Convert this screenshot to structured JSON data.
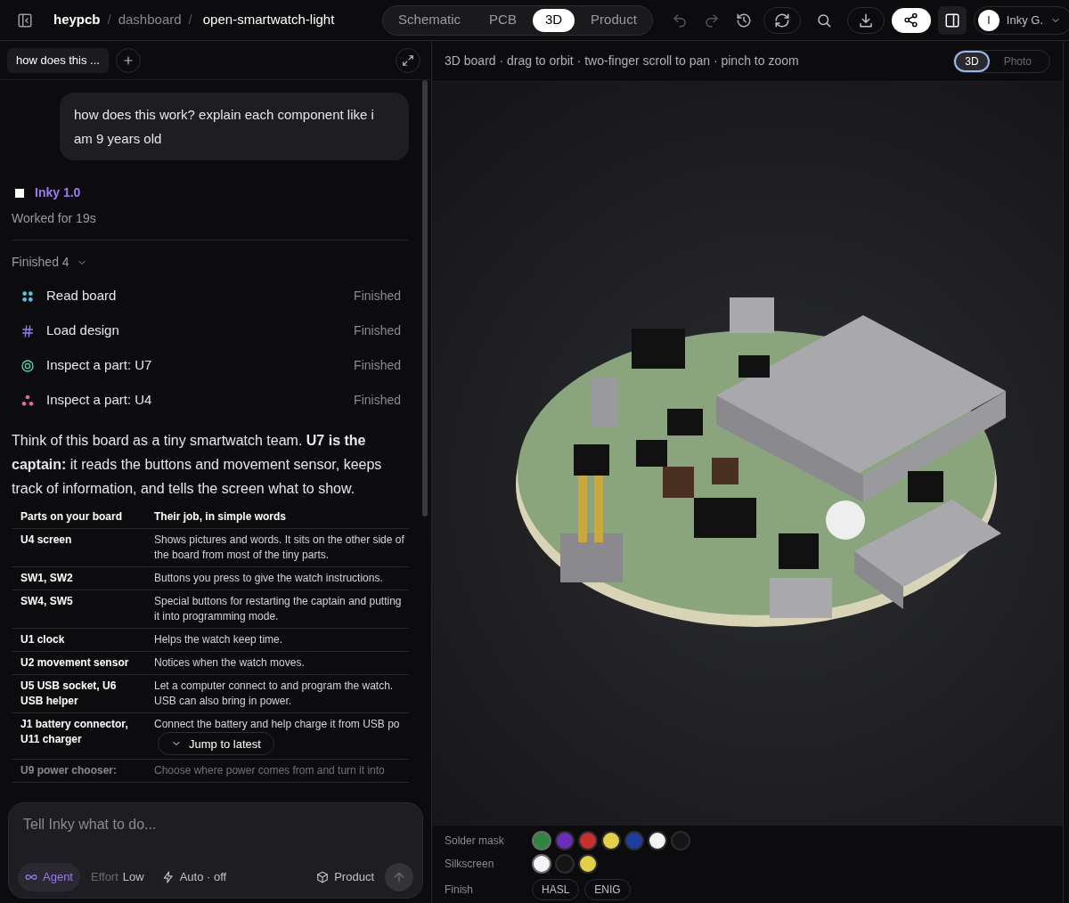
{
  "header": {
    "breadcrumb": [
      "heypcb",
      "dashboard",
      "open-smartwatch-light"
    ],
    "breadcrumb_separators": [
      "/",
      "/"
    ],
    "views": [
      {
        "label": "Schematic",
        "selected": false
      },
      {
        "label": "PCB",
        "selected": false
      },
      {
        "label": "3D",
        "selected": true
      },
      {
        "label": "Product",
        "selected": false
      }
    ],
    "user": {
      "initial": "I",
      "name": "Inky G."
    }
  },
  "chat": {
    "tab": "how does this ...",
    "user_message": "how does this work? explain each component like i am 9 years old",
    "agent": {
      "name": "Inky 1.0",
      "status": "Worked for 19s"
    },
    "steps_summary": "Finished 4",
    "steps": [
      {
        "kind": "grid",
        "label": "Read board",
        "status": "Finished"
      },
      {
        "kind": "hash",
        "label": "Load design",
        "status": "Finished"
      },
      {
        "kind": "target",
        "label": "Inspect a part: U7",
        "status": "Finished"
      },
      {
        "kind": "dots",
        "label": "Inspect a part: U4",
        "status": "Finished"
      }
    ],
    "answer": "Think of this board as a tiny smartwatch team. **U7 is the captain:** it reads the buttons and movement sensor, keeps track of information, and tells the screen what to show.",
    "table": {
      "columns": [
        "Parts on your board",
        "Their job, in simple words"
      ],
      "rows": [
        [
          "U4 screen",
          "Shows pictures and words. It sits on the other side of the board from most of the tiny parts."
        ],
        [
          "SW1, SW2",
          "Buttons you press to give the watch instructions."
        ],
        [
          "SW4, SW5",
          "Special buttons for restarting the captain and putting it into programming mode."
        ],
        [
          "U1 clock",
          "Helps the watch keep time."
        ],
        [
          "U2 movement sensor",
          "Notices when the watch moves."
        ],
        [
          "U5 USB socket, U6 USB helper",
          "Let a computer connect to and program the watch. USB can also bring in power."
        ],
        [
          "J1 battery connector, U11 charger",
          "Connect the battery and help charge it from USB po"
        ],
        [
          "U9 power chooser:",
          "Choose where power comes from and turn it into"
        ]
      ]
    },
    "jump_button": "Jump to latest",
    "composer": {
      "placeholder": "Tell Inky what to do...",
      "mode": "Agent",
      "effort_label": "Effort",
      "effort": "Low",
      "auto": "Auto · off",
      "target": "Product"
    }
  },
  "viewer": {
    "hint": "3D board · drag to orbit · two-finger scroll to pan · pinch to zoom",
    "toggle": [
      {
        "label": "3D",
        "selected": true
      },
      {
        "label": "Photo",
        "selected": false
      }
    ],
    "solder_mask": {
      "label": "Solder mask",
      "swatches": [
        {
          "color": "#2e8540",
          "selected": true
        },
        {
          "color": "#6a2fb8",
          "selected": false
        },
        {
          "color": "#c8302f",
          "selected": false
        },
        {
          "color": "#e3cf4a",
          "selected": false
        },
        {
          "color": "#1f3f9c",
          "selected": false
        },
        {
          "color": "#f4f4f4",
          "selected": false
        },
        {
          "color": "#151515",
          "selected": false
        }
      ]
    },
    "silkscreen": {
      "label": "Silkscreen",
      "swatches": [
        {
          "color": "#f4f4f4",
          "selected": true
        },
        {
          "color": "#151515",
          "selected": false
        },
        {
          "color": "#e3cf4a",
          "selected": false
        }
      ]
    },
    "finish": {
      "label": "Finish",
      "options": [
        "HASL",
        "ENIG"
      ]
    }
  }
}
